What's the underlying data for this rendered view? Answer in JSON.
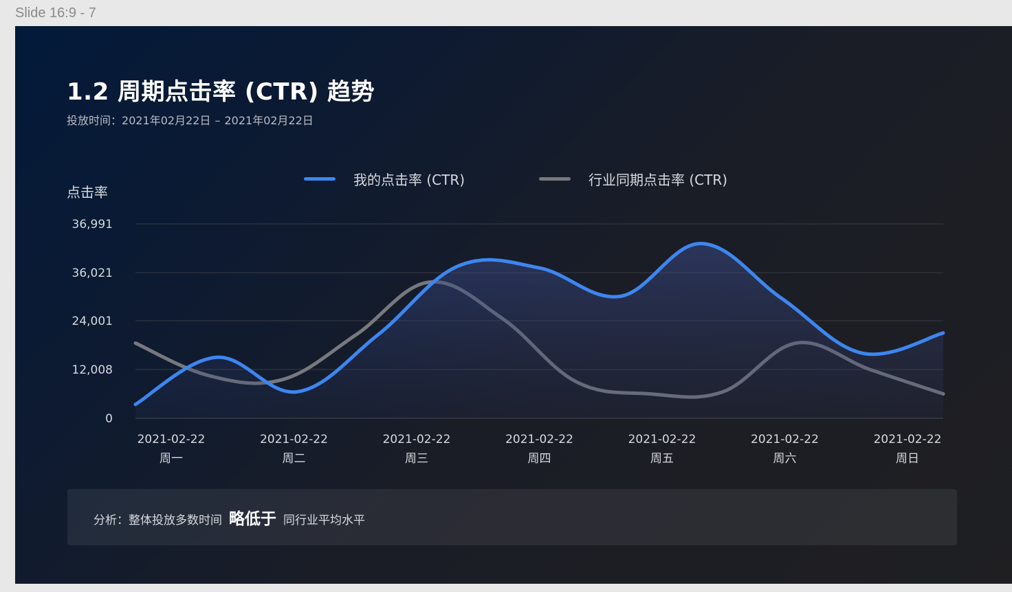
{
  "frame": {
    "label": "Slide 16:9 - 7"
  },
  "slide": {
    "title": "1.2 周期点击率 (CTR) 趋势",
    "subtitle_prefix": "投放时间：",
    "date_start": "2021年02月22日",
    "date_sep": "–",
    "date_end": "2021年02月22日"
  },
  "legend": {
    "mine": {
      "label": "我的点击率 (CTR)",
      "color": "#3d86f0"
    },
    "industry": {
      "label": "行业同期点击率 (CTR)",
      "color": "#77797e"
    }
  },
  "analysis": {
    "prefix": "分析：整体投放多数时间",
    "highlight": "略低于",
    "suffix": "同行业平均水平"
  },
  "chart_data": {
    "type": "line",
    "ylabel": "点击率",
    "y_ticks": [
      0,
      12008,
      24001,
      36021,
      36991
    ],
    "y_tick_labels": [
      "0",
      "12,008",
      "24,001",
      "36,021",
      "36,991"
    ],
    "categories": [
      {
        "date": "2021-02-22",
        "day": "周一"
      },
      {
        "date": "2021-02-22",
        "day": "周二"
      },
      {
        "date": "2021-02-22",
        "day": "周三"
      },
      {
        "date": "2021-02-22",
        "day": "周四"
      },
      {
        "date": "2021-02-22",
        "day": "周五"
      },
      {
        "date": "2021-02-22",
        "day": "周六"
      },
      {
        "date": "2021-02-22",
        "day": "周日"
      }
    ],
    "grid": true,
    "legend_position": "top-center",
    "series": [
      {
        "name": "我的点击率 (CTR)",
        "color": "#3d86f0",
        "area": true,
        "values": [
          3400,
          15000,
          6500,
          20500,
          37500,
          37000,
          30000,
          43000,
          29500,
          16000,
          21000
        ]
      },
      {
        "name": "行业同期点击率 (CTR)",
        "color": "#77797e",
        "area": false,
        "values": [
          18500,
          10500,
          9500,
          20500,
          33500,
          24500,
          9000,
          6000,
          6500,
          18500,
          12000,
          6000
        ]
      }
    ]
  }
}
